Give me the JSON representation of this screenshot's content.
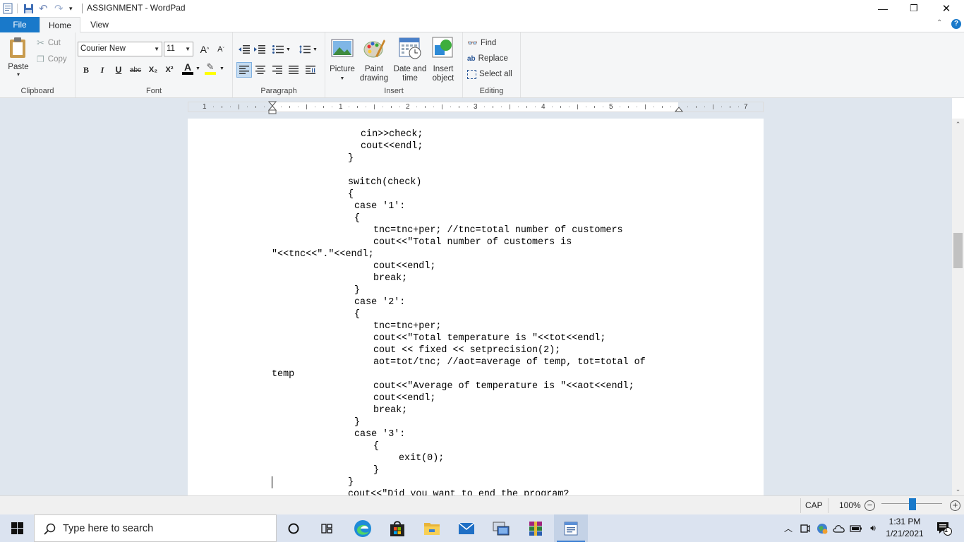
{
  "window": {
    "title": "ASSIGNMENT - WordPad",
    "minimize": "—",
    "maximize": "❐",
    "close": "✕"
  },
  "ribbon_tabs": [
    {
      "label": "File"
    },
    {
      "label": "Home"
    },
    {
      "label": "View"
    }
  ],
  "ribbon": {
    "clipboard": {
      "paste": "Paste",
      "cut": "Cut",
      "copy": "Copy",
      "label": "Clipboard"
    },
    "font": {
      "family": "Courier New",
      "size": "11",
      "grow": "A",
      "shrink": "A",
      "bold": "B",
      "italic": "I",
      "underline": "U",
      "strikethrough": "abc",
      "subscript": "X₂",
      "superscript": "X²",
      "text_color": "A",
      "text_color_value": "#000000",
      "highlight_color_value": "#ffff00",
      "label": "Font"
    },
    "paragraph": {
      "label": "Paragraph"
    },
    "insert": {
      "picture": "Picture",
      "paint_drawing_1": "Paint",
      "paint_drawing_2": "drawing",
      "date_time_1": "Date and",
      "date_time_2": "time",
      "insert_object_1": "Insert",
      "insert_object_2": "object",
      "label": "Insert"
    },
    "editing": {
      "find": "Find",
      "replace": "Replace",
      "select_all": "Select all",
      "label": "Editing"
    }
  },
  "ruler": {
    "numbers": [
      "1",
      "1",
      "2",
      "3",
      "4",
      "5",
      "7"
    ]
  },
  "document": {
    "lines": [
      {
        "indent": 7,
        "text": "cin>>check;"
      },
      {
        "indent": 7,
        "text": "cout<<endl;"
      },
      {
        "indent": 6,
        "text": "}"
      },
      {
        "indent": 6,
        "text": ""
      },
      {
        "indent": 6,
        "text": "switch(check)"
      },
      {
        "indent": 6,
        "text": "{"
      },
      {
        "indent": 6.5,
        "text": "case '1':"
      },
      {
        "indent": 6.5,
        "text": "{"
      },
      {
        "indent": 8,
        "text": "tnc=tnc+per; //tnc=total number of customers"
      },
      {
        "indent": 8,
        "text": "cout<<\"Total number of customers is"
      },
      {
        "indent": 0,
        "text": "\"<<tnc<<\".\"<<endl;"
      },
      {
        "indent": 8,
        "text": "cout<<endl;"
      },
      {
        "indent": 8,
        "text": "break;"
      },
      {
        "indent": 6.5,
        "text": "}"
      },
      {
        "indent": 6.5,
        "text": "case '2':"
      },
      {
        "indent": 6.5,
        "text": "{"
      },
      {
        "indent": 8,
        "text": "tnc=tnc+per;"
      },
      {
        "indent": 8,
        "text": "cout<<\"Total temperature is \"<<tot<<endl;"
      },
      {
        "indent": 8,
        "text": "cout << fixed << setprecision(2);"
      },
      {
        "indent": 8,
        "text": "aot=tot/tnc; //aot=average of temp, tot=total of"
      },
      {
        "indent": 0,
        "text": "temp"
      },
      {
        "indent": 8,
        "text": "cout<<\"Average of temperature is \"<<aot<<endl;"
      },
      {
        "indent": 8,
        "text": "cout<<endl;"
      },
      {
        "indent": 8,
        "text": "break;"
      },
      {
        "indent": 6.5,
        "text": "}"
      },
      {
        "indent": 6.5,
        "text": "case '3':"
      },
      {
        "indent": 8,
        "text": "{"
      },
      {
        "indent": 10,
        "text": "exit(0);"
      },
      {
        "indent": 8,
        "text": "}"
      },
      {
        "indent": 6,
        "text": "}"
      },
      {
        "indent": 6,
        "text": "cout<<\"Did you want to end the program?"
      }
    ]
  },
  "statusbar": {
    "caps": "CAP",
    "zoom": "100%",
    "zoom_out": "−",
    "zoom_in": "+",
    "zoom_level_percent": 100
  },
  "taskbar": {
    "search_placeholder": "Type here to search",
    "apps": [
      {
        "name": "cortana"
      },
      {
        "name": "task-view"
      },
      {
        "name": "edge"
      },
      {
        "name": "store"
      },
      {
        "name": "file-explorer"
      },
      {
        "name": "mail"
      },
      {
        "name": "remote-desktop"
      },
      {
        "name": "winrar"
      },
      {
        "name": "wordpad"
      }
    ],
    "time": "1:31 PM",
    "date": "1/21/2021",
    "notification_count": "1"
  },
  "colors": {
    "accent": "#1979ca",
    "doc_background": "#dfe6ee",
    "taskbar": "#dbe3f0"
  }
}
